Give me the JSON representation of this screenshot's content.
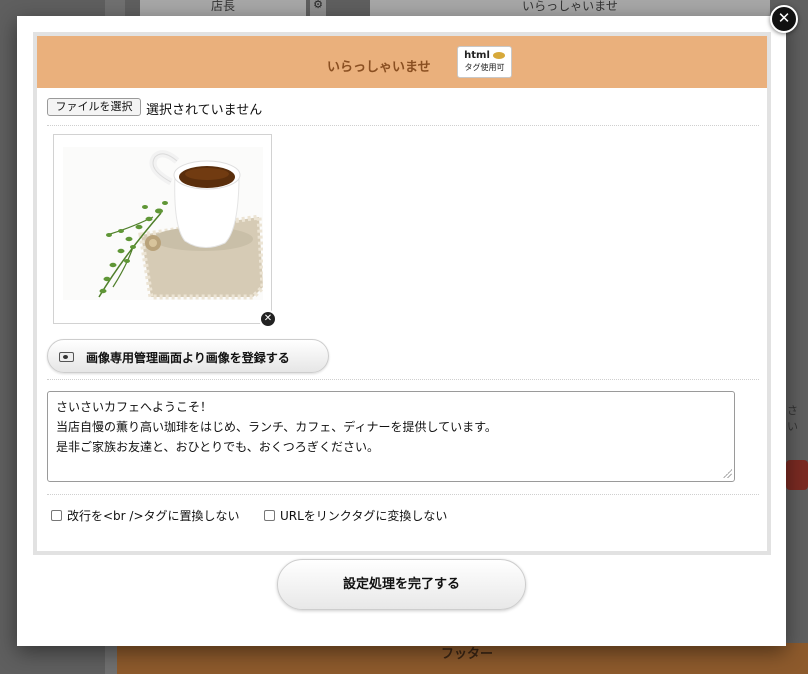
{
  "background": {
    "top_left_label": "店長",
    "top_right_label": "いらっしゃいませ",
    "footer_label": "フッター",
    "side_text": "さい"
  },
  "modal": {
    "close_glyph": "✕",
    "header": {
      "title": "いらっしゃいませ",
      "badge_line1": "html",
      "badge_line2": "タグ使用可"
    },
    "file_input": {
      "button_label": "ファイルを選択",
      "status_text": "選択されていません"
    },
    "image": {
      "remove_glyph": "✕"
    },
    "register_button_label": "画像専用管理画面より画像を登録する",
    "message_text": "さいさいカフェへようこそ！\n当店自慢の薫り高い珈琲をはじめ、ランチ、カフェ、ディナーを提供しています。\n是非ご家族お友達と、おひとりでも、おくつろぎください。",
    "options": [
      {
        "label": "改行を<br />タグに置換しない",
        "checked": false
      },
      {
        "label": "URLをリンクタグに変換しない",
        "checked": false
      }
    ],
    "submit_label": "設定処理を完了する"
  },
  "colors": {
    "header_bg": "#eab07c",
    "header_text": "#8a4f21"
  }
}
